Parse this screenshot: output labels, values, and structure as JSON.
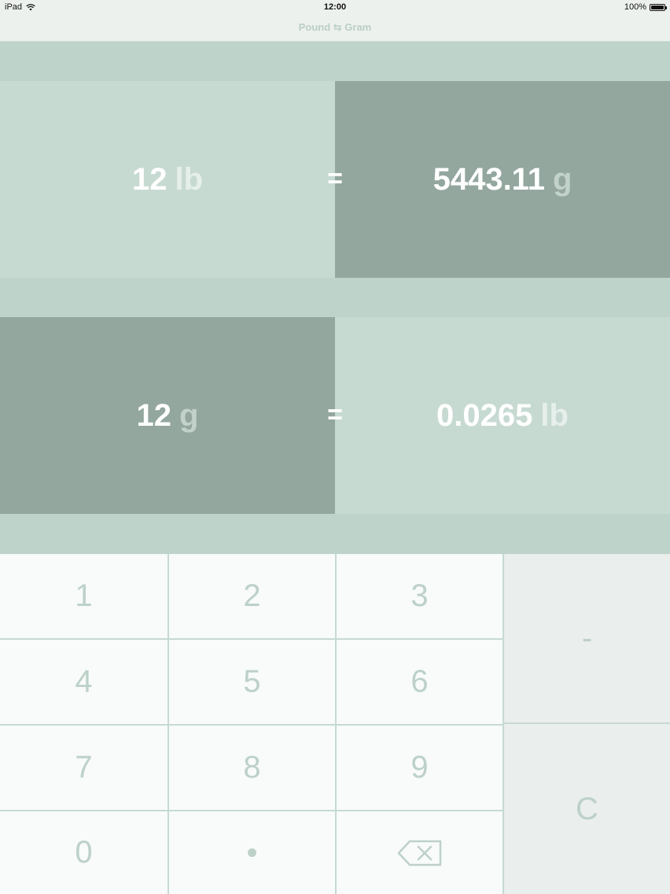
{
  "status_bar": {
    "device": "iPad",
    "time": "12:00",
    "battery": "100%"
  },
  "nav": {
    "title": "Pound ⇆ Gram"
  },
  "conversions": [
    {
      "input_value": "12",
      "input_unit": "lb",
      "equals": "=",
      "output_value": "5443.11",
      "output_unit": "g"
    },
    {
      "input_value": "12",
      "input_unit": "g",
      "equals": "=",
      "output_value": "0.0265",
      "output_unit": "lb"
    }
  ],
  "keypad": {
    "digits": [
      "1",
      "2",
      "3",
      "4",
      "5",
      "6",
      "7",
      "8",
      "9",
      "0"
    ],
    "minus": "-",
    "clear": "C",
    "decimal_icon": "dot-icon",
    "backspace_icon": "backspace-icon"
  },
  "colors": {
    "light_panel": "#c7dad2",
    "dark_panel": "#93a79f",
    "background": "#bed3c9",
    "key_text": "#bdd1c8"
  }
}
